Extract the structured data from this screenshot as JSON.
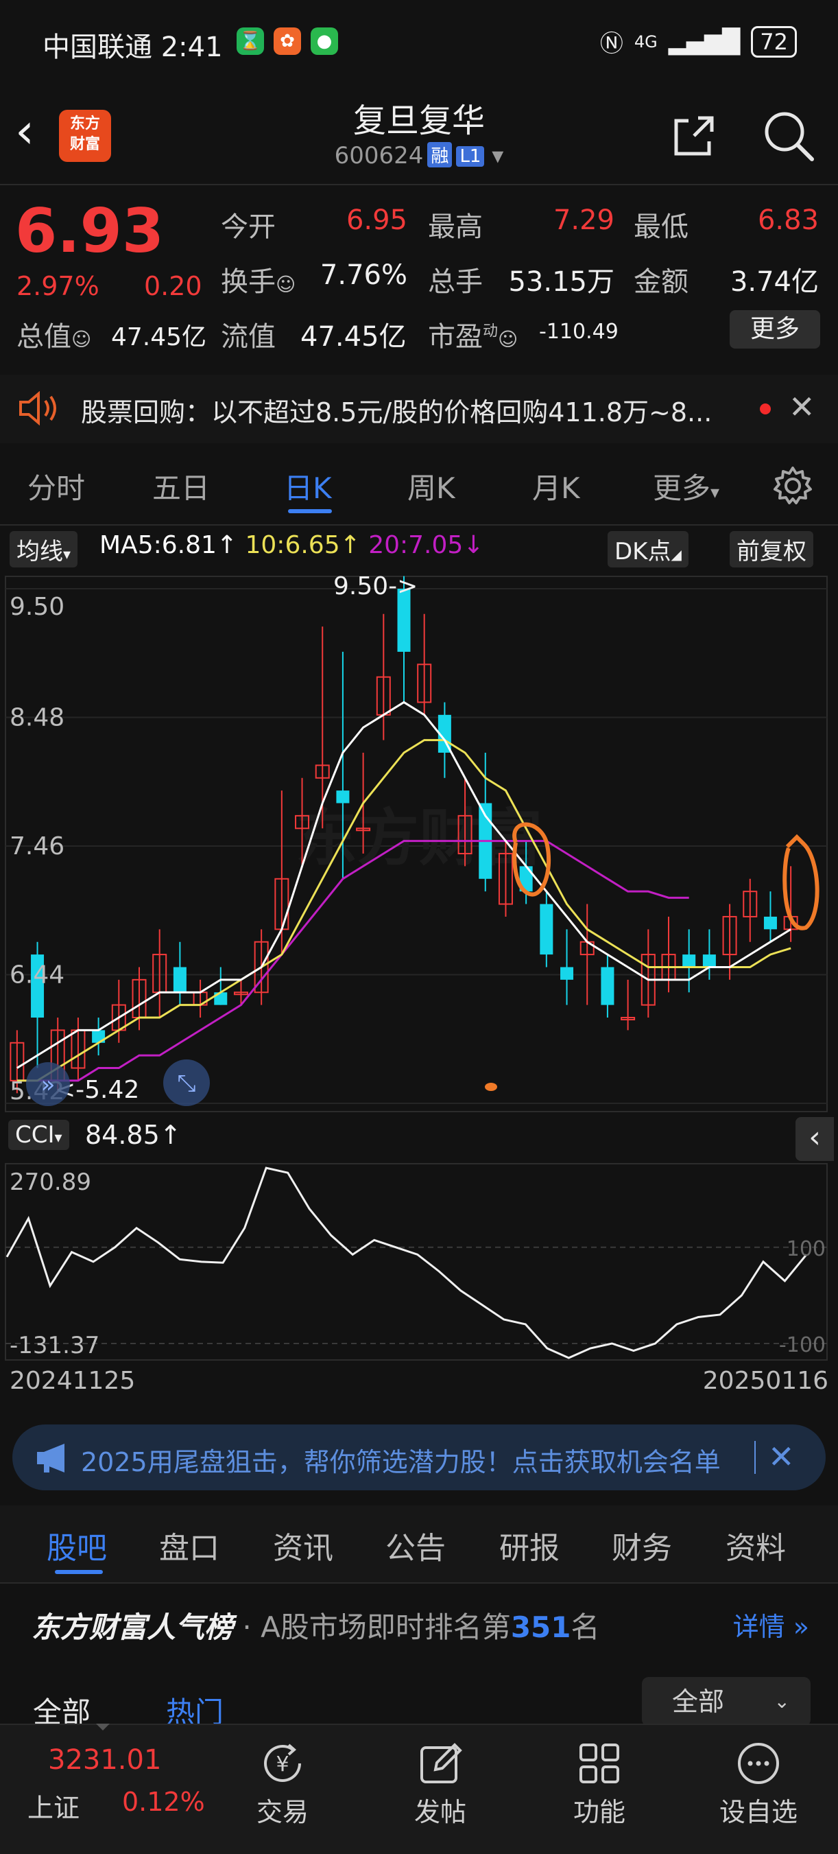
{
  "status": {
    "carrier_time": "中国联通 2:41",
    "network": "4G",
    "battery": "72"
  },
  "header": {
    "title": "复旦复华",
    "code": "600624",
    "tag1": "融",
    "tag2": "L1",
    "logo_line1": "东方",
    "logo_line2": "财富"
  },
  "quote": {
    "price": "6.93",
    "change_pct": "2.97%",
    "change": "0.20",
    "open_label": "今开",
    "open": "6.95",
    "high_label": "最高",
    "high": "7.29",
    "low_label": "最低",
    "low": "6.83",
    "turnover_label": "换手",
    "turnover": "7.76%",
    "volume_label": "总手",
    "volume": "53.15万",
    "amount_label": "金额",
    "amount": "3.74亿",
    "mktcap_label": "总值",
    "mktcap": "47.45亿",
    "float_label": "流值",
    "float_cap": "47.45亿",
    "pe_label": "市盈",
    "pe_sup": "动",
    "pe": "-110.49",
    "more": "更多"
  },
  "notice": {
    "text": "股票回购：以不超过8.5元/股的价格回购411.8万~8..."
  },
  "tabs": [
    "分时",
    "五日",
    "日K",
    "周K",
    "月K",
    "更多"
  ],
  "chart_toolbar": {
    "ma_label": "均线",
    "ma5": "MA5:6.81↑",
    "ma10": "10:6.65↑",
    "ma20": "20:7.05↓",
    "dk": "DK点",
    "adj": "前复权"
  },
  "chart_data": {
    "type": "candlestick",
    "y_ticks": [
      "9.50",
      "8.48",
      "7.46",
      "6.44",
      "5.42"
    ],
    "ylim": [
      5.42,
      9.5
    ],
    "max_label": "9.50->",
    "min_label": "<-5.42",
    "x_start": "20241125",
    "x_end": "20250116",
    "candles": [
      [
        5.9,
        5.6,
        5.5,
        6.0,
        "up"
      ],
      [
        6.1,
        6.6,
        5.7,
        6.7,
        "down"
      ],
      [
        5.6,
        6.0,
        5.5,
        6.1,
        "up"
      ],
      [
        5.7,
        6.0,
        5.6,
        6.1,
        "up"
      ],
      [
        5.9,
        6.0,
        5.8,
        6.1,
        "down"
      ],
      [
        6.0,
        6.2,
        5.9,
        6.4,
        "up"
      ],
      [
        6.1,
        6.4,
        6.0,
        6.5,
        "up"
      ],
      [
        6.3,
        6.6,
        6.1,
        6.8,
        "up"
      ],
      [
        6.5,
        6.3,
        6.2,
        6.7,
        "down"
      ],
      [
        6.2,
        6.3,
        6.1,
        6.4,
        "up"
      ],
      [
        6.3,
        6.2,
        6.2,
        6.5,
        "down"
      ],
      [
        6.3,
        6.3,
        6.2,
        6.4,
        "up"
      ],
      [
        6.3,
        6.7,
        6.2,
        6.8,
        "up"
      ],
      [
        6.8,
        7.2,
        6.6,
        7.9,
        "up"
      ],
      [
        7.6,
        7.7,
        7.3,
        8.0,
        "up"
      ],
      [
        8.0,
        8.1,
        7.6,
        9.2,
        "up"
      ],
      [
        7.9,
        7.8,
        7.2,
        9.0,
        "down"
      ],
      [
        7.6,
        7.6,
        7.4,
        8.2,
        "up"
      ],
      [
        8.5,
        8.8,
        8.3,
        9.3,
        "up"
      ],
      [
        9.5,
        9.0,
        8.6,
        9.6,
        "down"
      ],
      [
        8.6,
        8.9,
        8.5,
        9.3,
        "up"
      ],
      [
        8.5,
        8.2,
        8.0,
        8.6,
        "down"
      ],
      [
        7.4,
        7.7,
        7.3,
        8.0,
        "up"
      ],
      [
        7.8,
        7.2,
        7.1,
        8.2,
        "down"
      ],
      [
        7.0,
        7.4,
        6.9,
        7.5,
        "up"
      ],
      [
        7.3,
        7.1,
        7.0,
        7.5,
        "down"
      ],
      [
        7.0,
        6.6,
        6.5,
        7.1,
        "down"
      ],
      [
        6.5,
        6.4,
        6.2,
        6.8,
        "down"
      ],
      [
        6.6,
        6.7,
        6.2,
        7.0,
        "up"
      ],
      [
        6.5,
        6.2,
        6.1,
        6.6,
        "down"
      ],
      [
        6.1,
        6.1,
        6.0,
        6.4,
        "up"
      ],
      [
        6.2,
        6.6,
        6.1,
        6.8,
        "up"
      ],
      [
        6.4,
        6.6,
        6.3,
        6.9,
        "up"
      ],
      [
        6.6,
        6.5,
        6.3,
        6.8,
        "down"
      ],
      [
        6.6,
        6.5,
        6.4,
        6.8,
        "down"
      ],
      [
        6.6,
        6.9,
        6.4,
        7.0,
        "up"
      ],
      [
        6.9,
        7.1,
        6.7,
        7.2,
        "up"
      ],
      [
        6.9,
        6.8,
        6.7,
        7.1,
        "down"
      ],
      [
        6.8,
        6.9,
        6.7,
        7.3,
        "up"
      ]
    ],
    "ma5": [
      5.7,
      5.8,
      5.9,
      6.0,
      6.0,
      6.1,
      6.2,
      6.3,
      6.3,
      6.3,
      6.4,
      6.4,
      6.5,
      6.8,
      7.3,
      7.8,
      8.2,
      8.4,
      8.5,
      8.6,
      8.5,
      8.3,
      8.0,
      7.7,
      7.5,
      7.3,
      7.1,
      6.9,
      6.7,
      6.6,
      6.5,
      6.4,
      6.4,
      6.4,
      6.5,
      6.5,
      6.6,
      6.7,
      6.8
    ],
    "ma10": [
      5.6,
      5.6,
      5.7,
      5.8,
      5.9,
      6.0,
      6.1,
      6.1,
      6.2,
      6.2,
      6.3,
      6.4,
      6.5,
      6.6,
      6.9,
      7.2,
      7.5,
      7.8,
      8.0,
      8.2,
      8.3,
      8.3,
      8.2,
      8.0,
      7.9,
      7.6,
      7.3,
      7.0,
      6.8,
      6.7,
      6.6,
      6.5,
      6.5,
      6.5,
      6.5,
      6.5,
      6.5,
      6.6,
      6.65
    ],
    "ma20": [
      5.6,
      5.6,
      5.6,
      5.6,
      5.7,
      5.7,
      5.8,
      5.8,
      5.9,
      6.0,
      6.1,
      6.2,
      6.4,
      6.6,
      6.8,
      7.0,
      7.2,
      7.3,
      7.4,
      7.5,
      7.5,
      7.5,
      7.5,
      7.5,
      7.5,
      7.5,
      7.5,
      7.4,
      7.3,
      7.2,
      7.1,
      7.1,
      7.05,
      7.05
    ],
    "cci": {
      "label": "CCI",
      "value": "84.85↑",
      "top": "270.89",
      "bottom": "-131.37",
      "ref_hi": "100",
      "ref_lo": "-100",
      "ylim": [
        -131.37,
        270.89
      ],
      "values": [
        80,
        160,
        20,
        90,
        70,
        100,
        140,
        110,
        75,
        70,
        68,
        140,
        265,
        255,
        180,
        125,
        85,
        115,
        100,
        85,
        50,
        10,
        -20,
        -50,
        -60,
        -110,
        -130,
        -110,
        -100,
        -115,
        -100,
        -60,
        -45,
        -40,
        0,
        70,
        30,
        84.85
      ]
    }
  },
  "ad": {
    "text": "2025用尾盘狙击，帮你筛选潜力股！点击获取机会名单"
  },
  "subtabs": [
    "股吧",
    "盘口",
    "资讯",
    "公告",
    "研报",
    "财务",
    "资料"
  ],
  "rank": {
    "brand": "东方财富人气榜",
    "text_pre": "· A股市场即时排名第",
    "num": "351",
    "text_post": "名",
    "detail": "详情"
  },
  "filters": {
    "all": "全部",
    "hot": "热门",
    "select": "全部"
  },
  "bottom": {
    "index_val": "3231.01",
    "index_name": "上证",
    "index_pct": "0.12%",
    "nav": [
      "交易",
      "发帖",
      "功能",
      "设自选"
    ]
  },
  "colors": {
    "up": "#f23a3a",
    "down": "#17d6ea",
    "ma5": "#ffffff",
    "ma10": "#ece156",
    "ma20": "#c21fc4",
    "accent": "#3c7ff2"
  }
}
